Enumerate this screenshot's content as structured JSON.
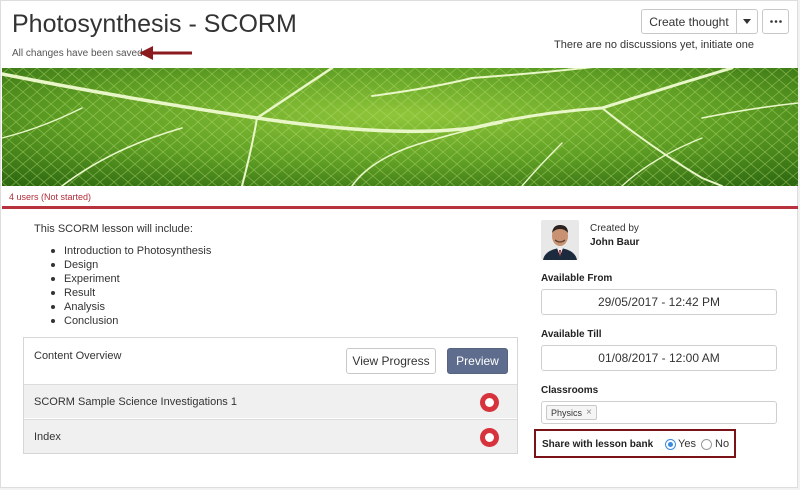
{
  "header": {
    "title": "Photosynthesis - SCORM",
    "save_status": "All changes have been saved",
    "create_thought_label": "Create thought",
    "discussion_text": "There are no discussions yet, initiate one"
  },
  "banner": {
    "image": "leaf-veins-photo"
  },
  "status": {
    "users_text": "4 users (Not started)",
    "accent_color": "#b8323d"
  },
  "lesson": {
    "intro": "This SCORM lesson will include:",
    "items": [
      "Introduction to Photosynthesis",
      "Design",
      "Experiment",
      "Result",
      "Analysis",
      "Conclusion"
    ]
  },
  "content_overview": {
    "title": "Content Overview",
    "view_progress_label": "View Progress",
    "preview_label": "Preview",
    "rows": [
      {
        "label": "SCORM Sample Science Investigations 1",
        "status_icon": "not-started-ring-icon"
      },
      {
        "label": "Index",
        "status_icon": "not-started-ring-icon"
      }
    ]
  },
  "sidebar": {
    "created_by_label": "Created by",
    "creator_name": "John Baur",
    "available_from_label": "Available From",
    "available_from_value": "29/05/2017 - 12:42 PM",
    "available_till_label": "Available Till",
    "available_till_value": "01/08/2017 - 12:00 AM",
    "classrooms_label": "Classrooms",
    "classrooms": [
      "Physics"
    ],
    "share_label": "Share with lesson bank",
    "share_yes_label": "Yes",
    "share_no_label": "No",
    "share_selected": "Yes"
  },
  "icons": {
    "caret": "chevron-down-icon",
    "more": "more-horizontal-icon",
    "annotation_arrow": "arrow-left-icon",
    "tag_remove": "close-icon"
  }
}
